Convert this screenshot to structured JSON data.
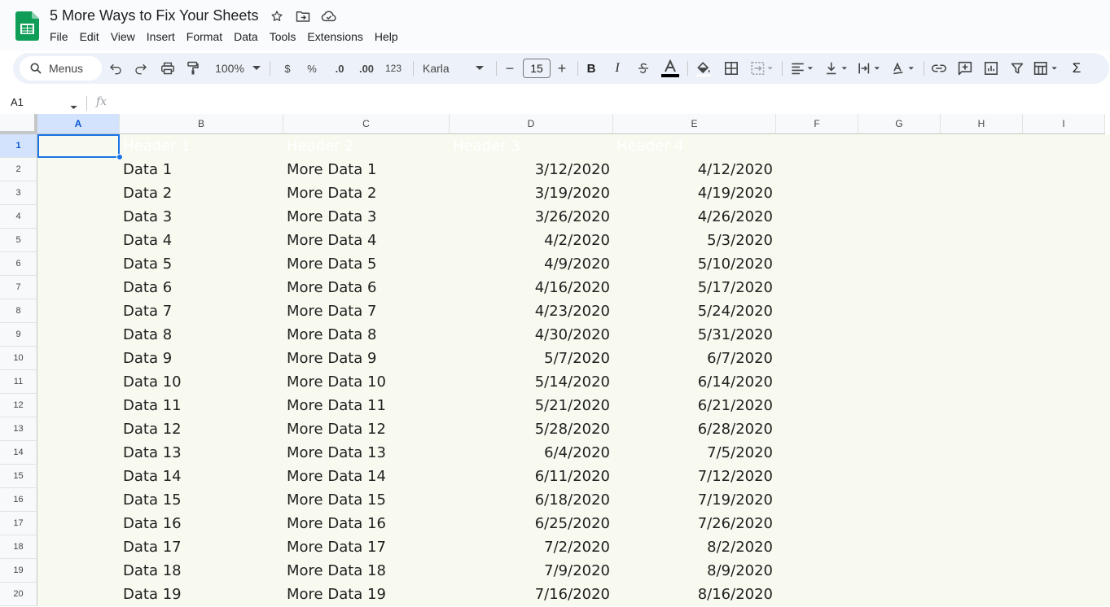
{
  "app": {
    "document_title": "5 More Ways to Fix Your Sheets",
    "icons": [
      "star-icon",
      "move-folder-icon",
      "cloud-status-icon"
    ],
    "brand_color": "#0f9d58"
  },
  "menubar": [
    "File",
    "Edit",
    "View",
    "Insert",
    "Format",
    "Data",
    "Tools",
    "Extensions",
    "Help"
  ],
  "toolbar": {
    "search_label": "Menus",
    "zoom": "100%",
    "currency": "$",
    "percent": "%",
    "decrease_decimal": ".0",
    "increase_decimal": ".00",
    "number_format": "123",
    "font": "Karla",
    "font_size": "15",
    "minus": "−",
    "plus": "+",
    "bold": "B",
    "italic": "I",
    "sum": "Σ"
  },
  "formula_bar": {
    "cell_ref": "A1",
    "fx": "fx"
  },
  "columns": [
    "A",
    "B",
    "C",
    "D",
    "E",
    "F",
    "G",
    "H",
    "I"
  ],
  "selected_column": "A",
  "selected_row": "1",
  "row_numbers": [
    "1",
    "2",
    "3",
    "4",
    "5",
    "6",
    "7",
    "8",
    "9",
    "10",
    "11",
    "12",
    "13",
    "14",
    "15",
    "16",
    "17",
    "18",
    "19",
    "20"
  ],
  "header_row": [
    "",
    "Header 1",
    "Header 2",
    "Header 3",
    "Header 4"
  ],
  "rows": [
    [
      "Data 1",
      "More Data 1",
      "3/12/2020",
      "4/12/2020"
    ],
    [
      "Data 2",
      "More Data 2",
      "3/19/2020",
      "4/19/2020"
    ],
    [
      "Data 3",
      "More Data 3",
      "3/26/2020",
      "4/26/2020"
    ],
    [
      "Data 4",
      "More Data 4",
      "4/2/2020",
      "5/3/2020"
    ],
    [
      "Data 5",
      "More Data 5",
      "4/9/2020",
      "5/10/2020"
    ],
    [
      "Data 6",
      "More Data 6",
      "4/16/2020",
      "5/17/2020"
    ],
    [
      "Data 7",
      "More Data 7",
      "4/23/2020",
      "5/24/2020"
    ],
    [
      "Data 8",
      "More Data 8",
      "4/30/2020",
      "5/31/2020"
    ],
    [
      "Data 9",
      "More Data 9",
      "5/7/2020",
      "6/7/2020"
    ],
    [
      "Data 10",
      "More Data 10",
      "5/14/2020",
      "6/14/2020"
    ],
    [
      "Data 11",
      "More Data 11",
      "5/21/2020",
      "6/21/2020"
    ],
    [
      "Data 12",
      "More Data 12",
      "5/28/2020",
      "6/28/2020"
    ],
    [
      "Data 13",
      "More Data 13",
      "6/4/2020",
      "7/5/2020"
    ],
    [
      "Data 14",
      "More Data 14",
      "6/11/2020",
      "7/12/2020"
    ],
    [
      "Data 15",
      "More Data 15",
      "6/18/2020",
      "7/19/2020"
    ],
    [
      "Data 16",
      "More Data 16",
      "6/25/2020",
      "7/26/2020"
    ],
    [
      "Data 17",
      "More Data 17",
      "7/2/2020",
      "8/2/2020"
    ],
    [
      "Data 18",
      "More Data 18",
      "7/9/2020",
      "8/9/2020"
    ],
    [
      "Data 19",
      "More Data 19",
      "7/16/2020",
      "8/16/2020"
    ]
  ]
}
